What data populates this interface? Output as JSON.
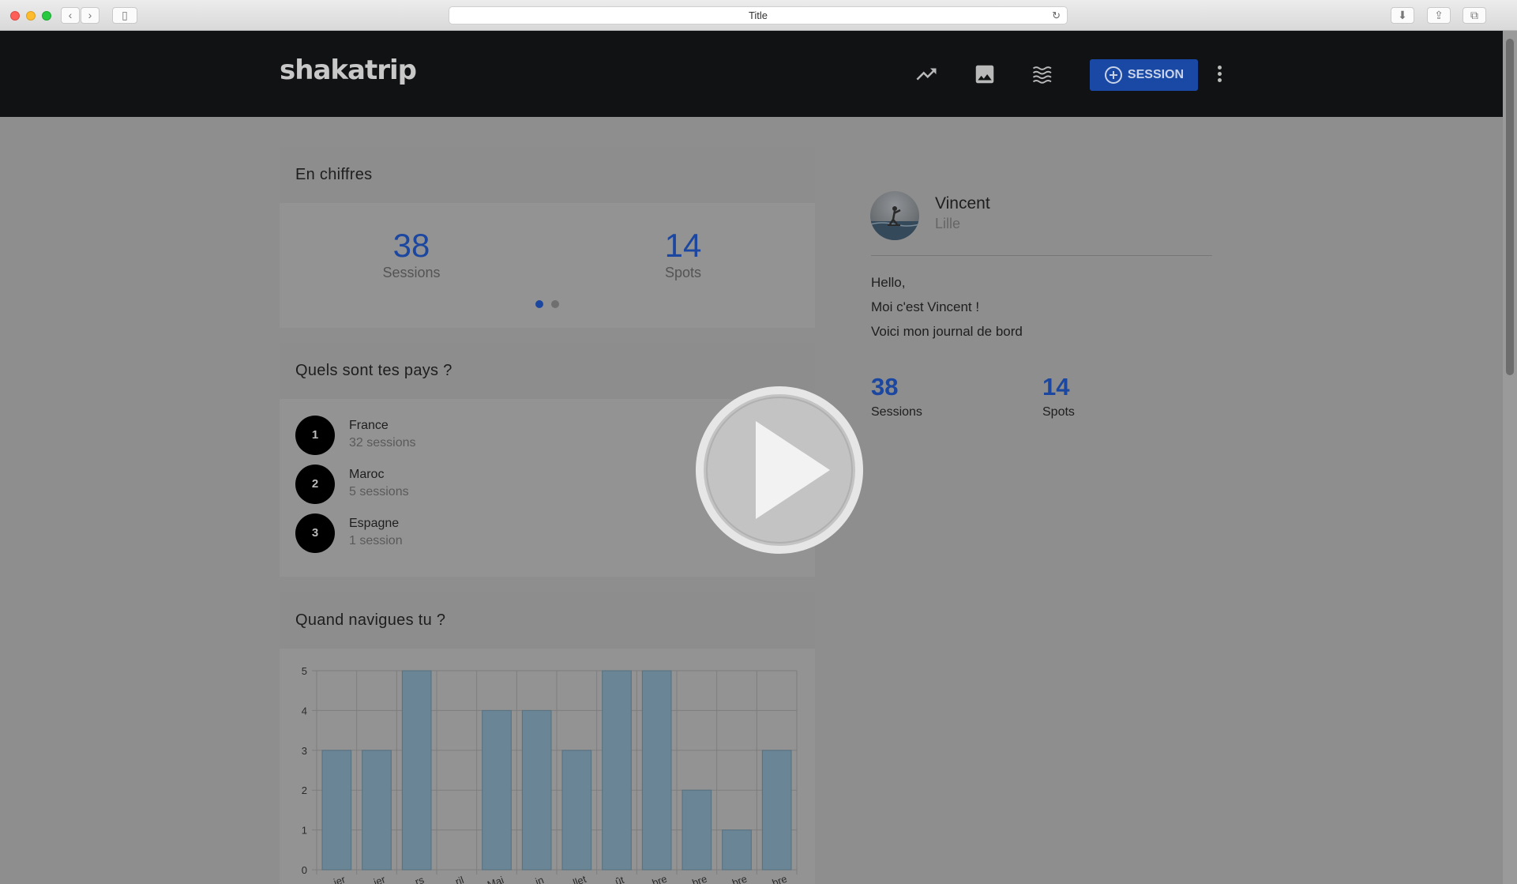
{
  "browser": {
    "address_title": "Title"
  },
  "header": {
    "logo": "shakatrip",
    "session_button_label": "SESSION"
  },
  "stats_card": {
    "title": "En chiffres",
    "sessions_count": "38",
    "sessions_label": "Sessions",
    "spots_count": "14",
    "spots_label": "Spots"
  },
  "countries_card": {
    "title": "Quels sont tes pays ?",
    "items": [
      {
        "rank": "1",
        "name": "France",
        "sessions": "32 sessions"
      },
      {
        "rank": "2",
        "name": "Maroc",
        "sessions": "5 sessions"
      },
      {
        "rank": "3",
        "name": "Espagne",
        "sessions": "1 session"
      }
    ]
  },
  "months_card": {
    "title": "Quand navigues tu ?"
  },
  "profile": {
    "name": "Vincent",
    "city": "Lille",
    "bio": [
      "Hello,",
      "Moi c'est Vincent !",
      "Voici mon journal de bord"
    ],
    "sessions_count": "38",
    "sessions_label": "Sessions",
    "spots_count": "14",
    "spots_label": "Spots"
  },
  "chart_data": {
    "type": "bar",
    "categories": [
      "...ier",
      "...ier",
      "...rs",
      "...ril",
      "Mai",
      "...in",
      "...llet",
      "...ût",
      "...bre",
      "...bre",
      "...bre",
      "...bre"
    ],
    "values": [
      3,
      3,
      5,
      0,
      4,
      4,
      3,
      5,
      5,
      2,
      1,
      3
    ],
    "yticks": [
      "0",
      "1",
      "2",
      "3",
      "4",
      "5"
    ],
    "ylim": [
      0,
      5
    ],
    "grid": true,
    "bar_color": "#6a8596"
  },
  "colors": {
    "accent": "#1c47a0",
    "header_bg": "#111214"
  }
}
